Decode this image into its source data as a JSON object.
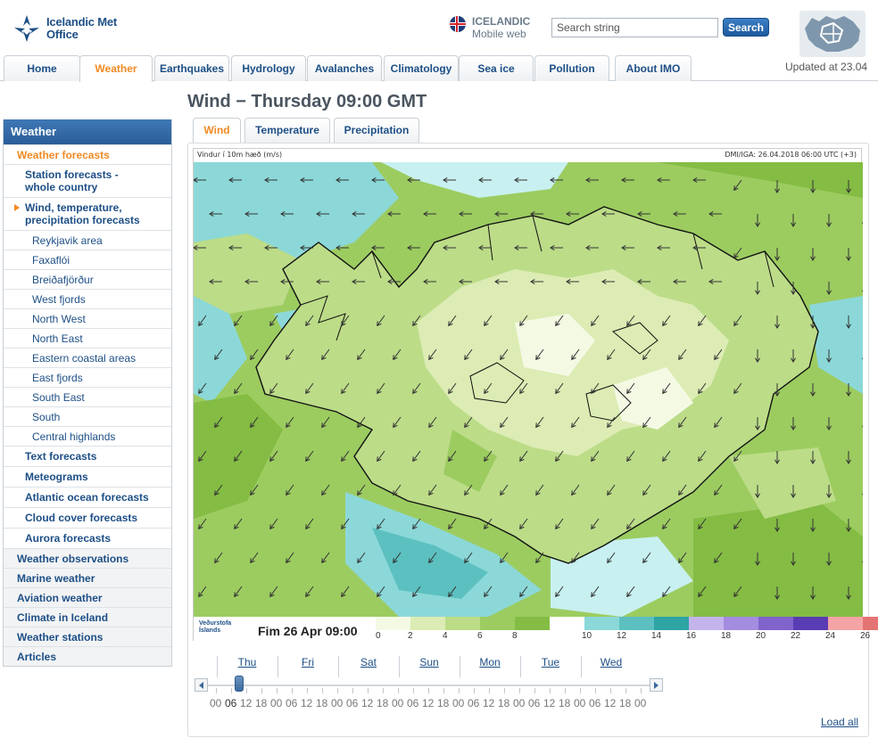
{
  "header": {
    "logo_line1": "Icelandic Met",
    "logo_line2": "Office",
    "mobile_line1": "ICELANDIC",
    "mobile_line2": "Mobile web",
    "search_placeholder": "Search string",
    "search_button": "Search",
    "updated": "Updated at 23.04"
  },
  "topnav": [
    "Home",
    "Weather",
    "Earthquakes",
    "Hydrology",
    "Avalanches",
    "Climatology",
    "Sea ice",
    "Pollution",
    "About IMO"
  ],
  "topnav_active": "Weather",
  "sidebar": {
    "title": "Weather",
    "items": [
      {
        "label": "Weather forecasts",
        "level": 0,
        "active": true
      },
      {
        "label": "Station forecasts - whole country",
        "level": 1
      },
      {
        "label": "Wind, temperature, precipitation forecasts",
        "level": 1,
        "active": true
      },
      {
        "label": "Reykjavik area",
        "level": 2
      },
      {
        "label": "Faxaflói",
        "level": 2
      },
      {
        "label": "Breiðafjörður",
        "level": 2
      },
      {
        "label": "West fjords",
        "level": 2
      },
      {
        "label": "North West",
        "level": 2
      },
      {
        "label": "North East",
        "level": 2
      },
      {
        "label": "Eastern coastal areas",
        "level": 2
      },
      {
        "label": "East fjords",
        "level": 2
      },
      {
        "label": "South East",
        "level": 2
      },
      {
        "label": "South",
        "level": 2
      },
      {
        "label": "Central highlands",
        "level": 2
      },
      {
        "label": "Text forecasts",
        "level": 1
      },
      {
        "label": "Meteograms",
        "level": 1
      },
      {
        "label": "Atlantic ocean forecasts",
        "level": 1
      },
      {
        "label": "Cloud cover forecasts",
        "level": 1
      },
      {
        "label": "Aurora forecasts",
        "level": 1
      },
      {
        "label": "Weather observations",
        "level": 0
      },
      {
        "label": "Marine weather",
        "level": 0
      },
      {
        "label": "Aviation weather",
        "level": 0
      },
      {
        "label": "Climate in Iceland",
        "level": 0
      },
      {
        "label": "Weather stations",
        "level": 0
      },
      {
        "label": "Articles",
        "level": 0
      }
    ]
  },
  "main": {
    "title": "Wind − Thursday 09:00 GMT",
    "tabs": [
      "Wind",
      "Temperature",
      "Precipitation"
    ],
    "active_tab": "Wind"
  },
  "map": {
    "caption_left": "Vindur í 10m hæð (m/s)",
    "caption_right": "DMI/IGA: 26.04.2018 06:00 UTC (+3)",
    "logo_line1": "Veðurstofa",
    "logo_line2": "Íslands",
    "date_label": "Fim 26 Apr 09:00",
    "legend_values": [
      "0",
      "2",
      "4",
      "6",
      "8",
      "10",
      "12",
      "14",
      "16",
      "18",
      "20",
      "22",
      "24",
      "26"
    ],
    "legend_colors": [
      "#f4f9e4",
      "#dcecb4",
      "#bcdc88",
      "#9ccc60",
      "#84bc44",
      "#ffffff",
      "#8cd8d8",
      "#5cc0c0",
      "#2ea4a4",
      "#c4b4ec",
      "#a48ce0",
      "#8064cc",
      "#5a3cb4",
      "#f4a4a4",
      "#e47474"
    ]
  },
  "timeline": {
    "days": [
      "Thu",
      "Fri",
      "Sat",
      "Sun",
      "Mon",
      "Tue",
      "Wed"
    ],
    "hours": [
      "00",
      "06",
      "12",
      "18",
      "00",
      "06",
      "12",
      "18",
      "00",
      "06",
      "12",
      "18",
      "00",
      "06",
      "12",
      "18",
      "00",
      "06",
      "12",
      "18",
      "00",
      "06",
      "12",
      "18",
      "00",
      "06",
      "12",
      "18",
      "00"
    ],
    "selected_index": 1,
    "load_all": "Load all"
  }
}
